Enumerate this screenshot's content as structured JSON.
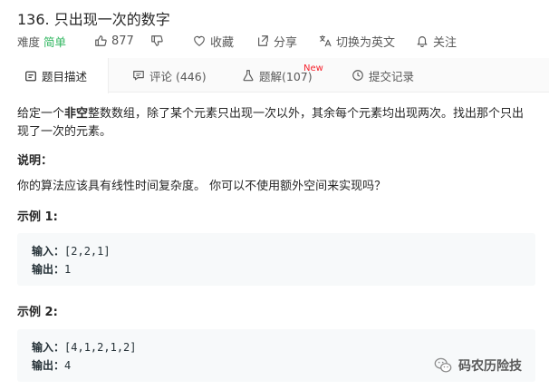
{
  "problem": {
    "title": "136. 只出现一次的数字",
    "difficulty_label": "难度",
    "difficulty_value": "简单"
  },
  "meta": {
    "likes": "877",
    "favorite_label": "收藏",
    "share_label": "分享",
    "translate_label": "切换为英文",
    "follow_label": "关注"
  },
  "tabs": [
    {
      "label": "题目描述",
      "icon": "document-icon"
    },
    {
      "label": "评论 (446)",
      "icon": "comment-icon"
    },
    {
      "label": "题解(107)",
      "icon": "flask-icon",
      "badge": "New"
    },
    {
      "label": "提交记录",
      "icon": "clock-icon"
    }
  ],
  "description": {
    "intro_pre": "给定一个",
    "intro_bold": "非空",
    "intro_post": "整数数组，除了某个元素只出现一次以外，其余每个元素均出现两次。找出那个只出现了一次的元素。",
    "note_heading": "说明：",
    "note_text": "你的算法应该具有线性时间复杂度。 你可以不使用额外空间来实现吗？",
    "example1_heading": "示例 1:",
    "example1_input_label": "输入：",
    "example1_input": "[2,2,1]",
    "example1_output_label": "输出：",
    "example1_output": "1",
    "example2_heading": "示例 2:",
    "example2_input_label": "输入：",
    "example2_input": "[4,1,2,1,2]",
    "example2_output_label": "输出：",
    "example2_output": "4"
  },
  "watermark": {
    "text": "码农历险技"
  },
  "colors": {
    "easy_green": "#2db55d",
    "new_red": "#f5222d",
    "code_bg": "#f7f9fa"
  }
}
